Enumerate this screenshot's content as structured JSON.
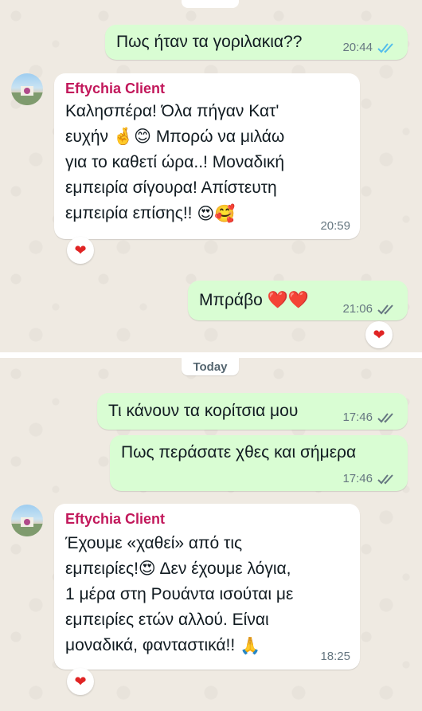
{
  "contact": {
    "name": "Eftychia Client"
  },
  "section1": {
    "messages": [
      {
        "text": "Πως ήταν τα γοριλακια??",
        "time": "20:44",
        "status": "read"
      },
      {
        "sender": "Eftychia Client",
        "lines": [
          "Καλησπέρα! Όλα πήγαν Κατ'",
          "ευχήν",
          "Μπορώ να μιλάω",
          "για το καθετί ώρα..! Μοναδική",
          "εμπειρία σίγουρα! Απίστευτη",
          "εμπειρία επίσης!!"
        ],
        "time": "20:59",
        "reaction": "❤"
      },
      {
        "text": "Μπράβο",
        "time": "21:06",
        "status": "delivered",
        "reaction": "❤"
      }
    ]
  },
  "section2": {
    "date_label": "Today",
    "messages": [
      {
        "text": "Τι κάνουν τα κορίτσια μου",
        "time": "17:46",
        "status": "delivered"
      },
      {
        "text": "Πως περάσατε χθες και σήμερα",
        "time": "17:46",
        "status": "delivered"
      },
      {
        "sender": "Eftychia Client",
        "lines": [
          "Έχουμε «χαθεί» από τις",
          "εμπειρίες!",
          "Δεν έχουμε λόγια,",
          "1 μέρα στη Ρουάντα ισούται με",
          "εμπειρίες ετών αλλού. Είναι",
          "μοναδικά, φανταστικά!!"
        ],
        "time": "18:25",
        "reaction": "❤"
      }
    ]
  },
  "colors": {
    "background": "#efeae2",
    "outgoing": "#d9fdd3",
    "incoming": "#ffffff",
    "sender_name": "#c2185b",
    "read_ticks": "#53bdeb",
    "delivered_ticks": "#667781",
    "reaction_heart": "#e02424"
  },
  "icons": [
    "double-check-read-icon",
    "double-check-delivered-icon",
    "heart-reaction-icon",
    "crossed-fingers-emoji",
    "smiling-face-emoji",
    "heart-eyes-emoji",
    "smiling-face-with-hearts-emoji",
    "red-heart-emoji",
    "folded-hands-emoji"
  ]
}
